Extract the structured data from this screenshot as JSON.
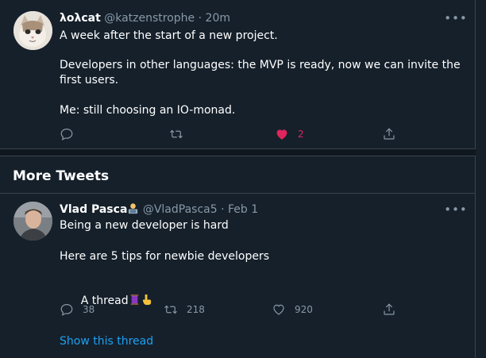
{
  "tweets": [
    {
      "display_name": "λολcat",
      "handle": "@katzenstrophe",
      "separator": "·",
      "time": "20m",
      "text_lines": [
        "A week after the start of a new project.",
        "Developers in other languages: the MVP is ready, now we can invite the first users.",
        "Me: still choosing an IO-monad."
      ],
      "actions": {
        "reply_count": "",
        "retweet_count": "",
        "like_count": "2",
        "liked": true
      },
      "icons": {
        "avatar": "cat-avatar",
        "more": "more-dots-icon"
      }
    },
    {
      "display_name": "Vlad Pasca",
      "handle": "@VladPasca5",
      "separator": "·",
      "time": "Feb 1",
      "text_lines": [
        "Being a new developer is hard",
        "Here are 5 tips for newbie developers",
        "A thread"
      ],
      "actions": {
        "reply_count": "38",
        "retweet_count": "218",
        "like_count": "920",
        "liked": false
      },
      "icons": {
        "name_emoji": "technologist-emoji",
        "thread_emojis": [
          "thread-spool-emoji",
          "pointing-down-emoji"
        ]
      }
    }
  ],
  "section": {
    "title": "More Tweets"
  },
  "show_thread": "Show this thread",
  "colors": {
    "background": "#15202b",
    "border": "#38444d",
    "secondary_text": "#8899a6",
    "link": "#1da1f2",
    "like": "#e0245e"
  }
}
